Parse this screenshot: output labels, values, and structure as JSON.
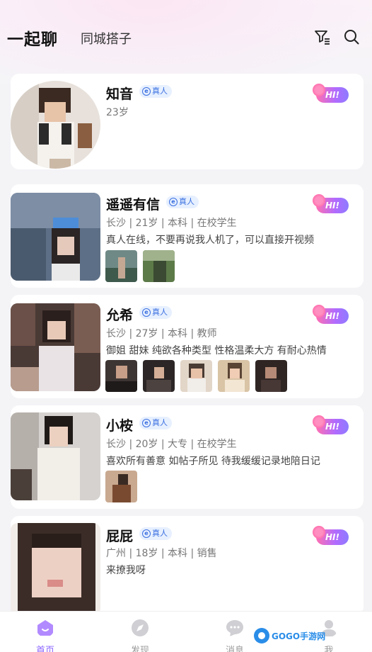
{
  "header": {
    "tab_active": "一起聊",
    "tab_inactive": "同城搭子",
    "filter_icon": "filter-icon",
    "search_icon": "search-icon"
  },
  "badge_label": "真人",
  "hi_label": "HI!",
  "users": [
    {
      "name": "知音",
      "meta": "23岁",
      "bio": "",
      "thumbs": 0
    },
    {
      "name": "遥遥有信",
      "meta": "长沙 | 21岁 | 本科 | 在校学生",
      "bio": "真人在线，不要再说我人机了，可以直接开视频",
      "thumbs": 2
    },
    {
      "name": "允希",
      "meta": "长沙 | 27岁 | 本科 | 教师",
      "bio": "御姐 甜妹 纯欲各种类型 性格温柔大方 有耐心热情",
      "thumbs": 5
    },
    {
      "name": "小桉",
      "meta": "长沙 | 20岁 | 大专 | 在校学生",
      "bio": "喜欢所有善意 如帖子所见 待我缓缓记录地陪日记",
      "thumbs": 1
    },
    {
      "name": "屁屁",
      "meta": "广州 | 18岁 | 本科 | 销售",
      "bio": "来撩我呀",
      "thumbs": 0
    }
  ],
  "tabbar": [
    {
      "label": "首页",
      "icon": "home-icon"
    },
    {
      "label": "发现",
      "icon": "discover-icon"
    },
    {
      "label": "消息",
      "icon": "message-icon"
    },
    {
      "label": "我",
      "icon": "profile-icon"
    }
  ],
  "watermark": "GOGO手游网",
  "colors": {
    "accent": "#8a63ff",
    "badge": "#3a6fe0"
  }
}
